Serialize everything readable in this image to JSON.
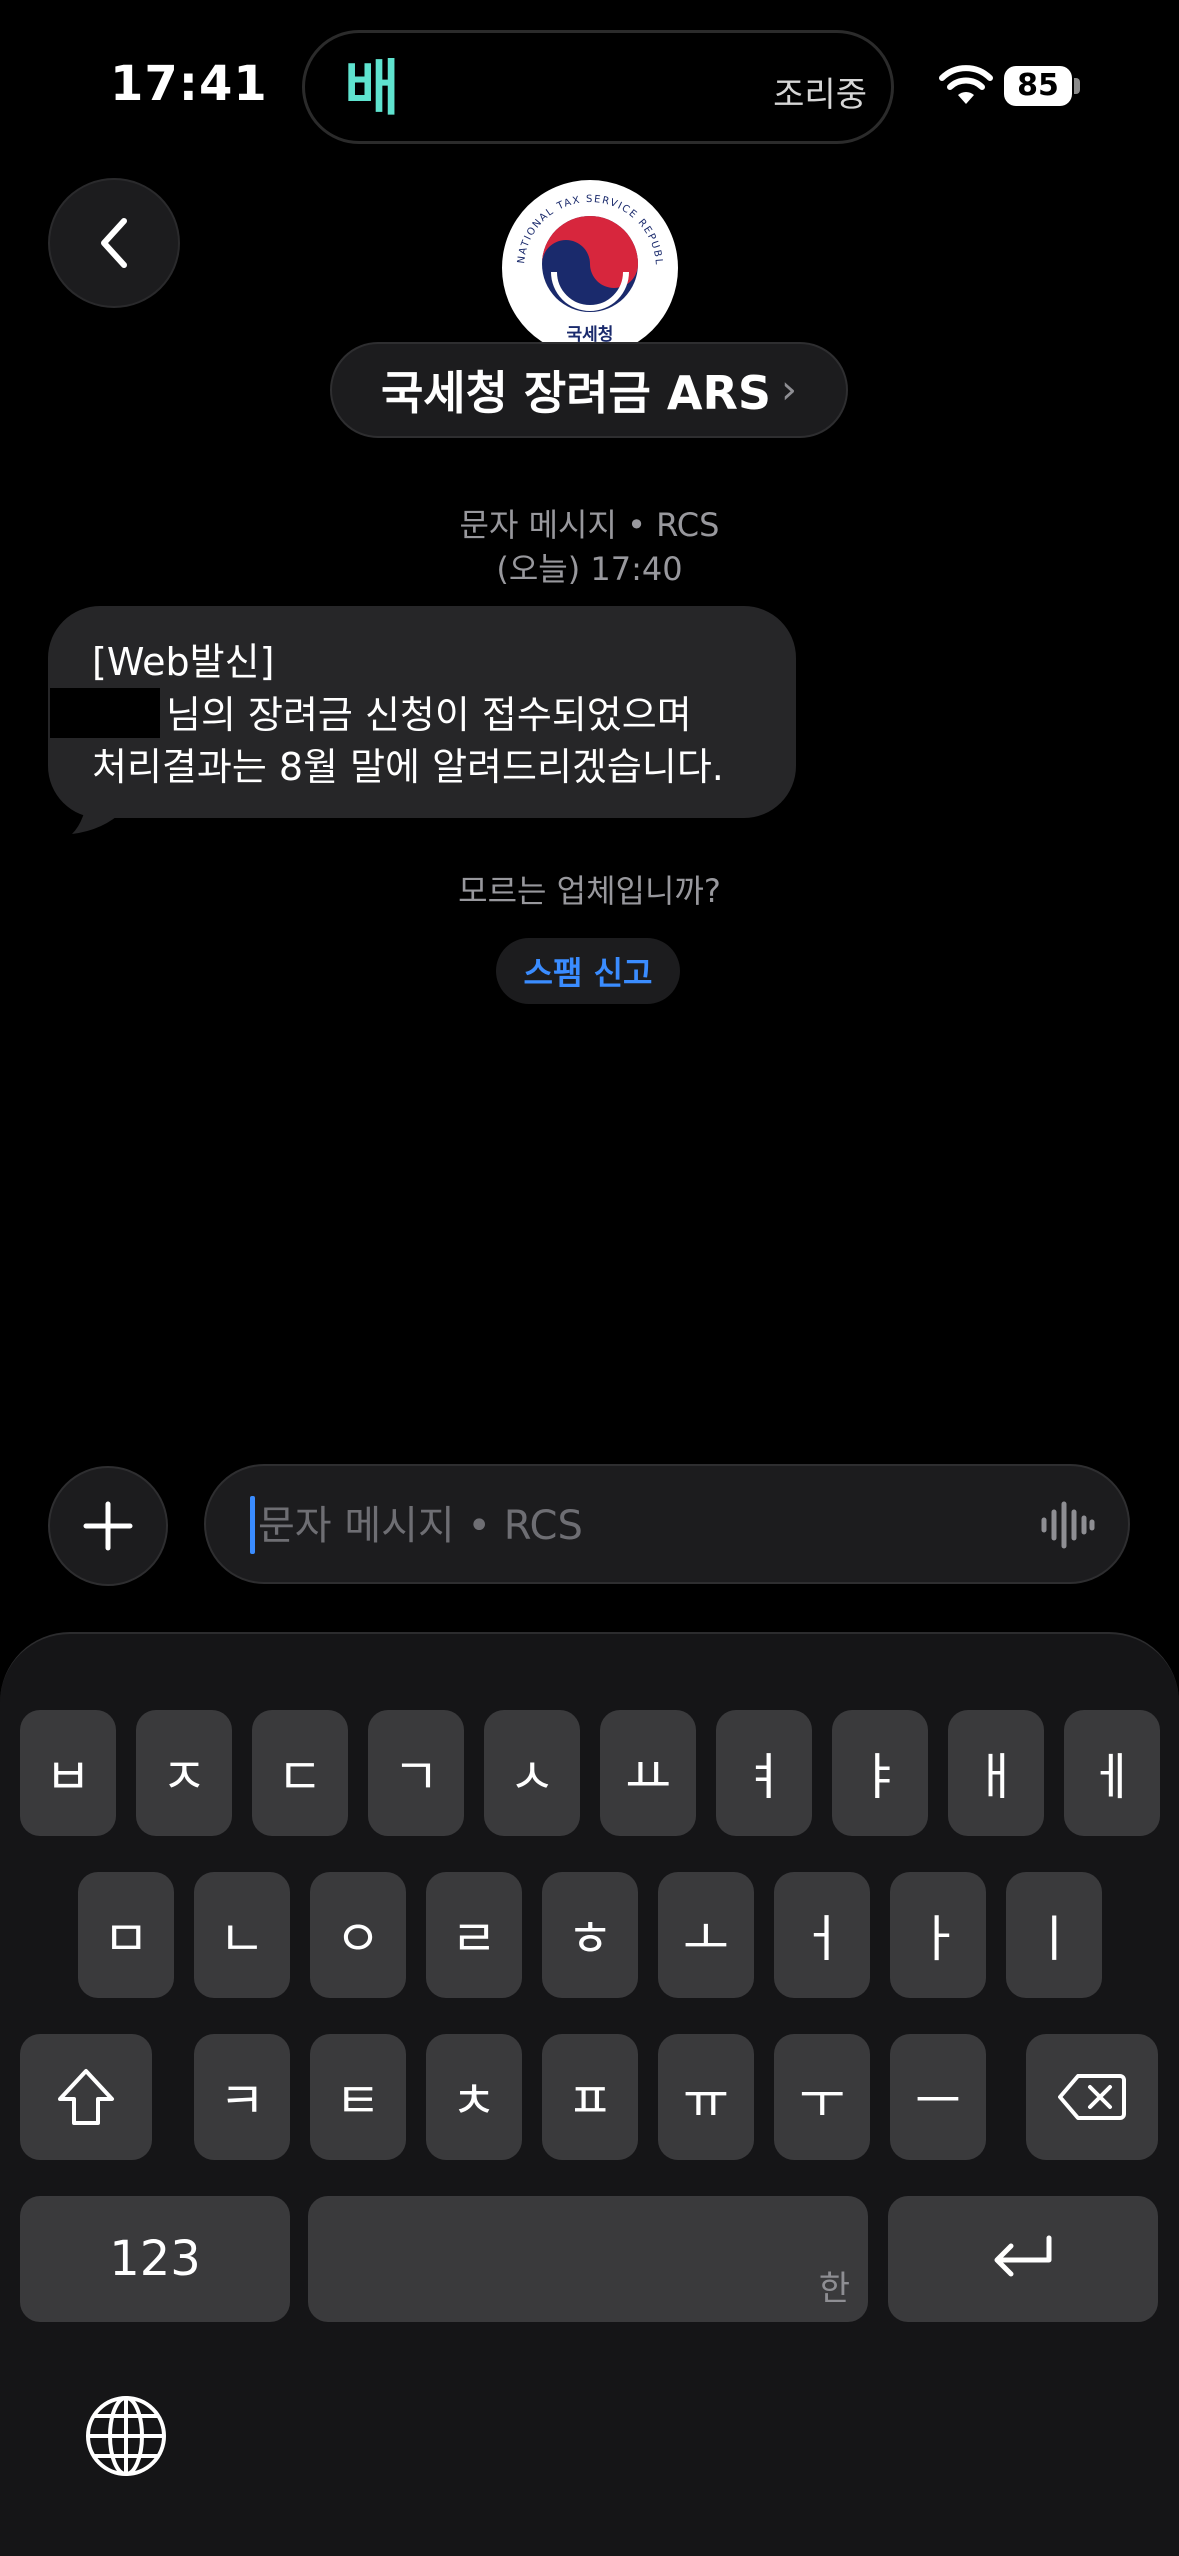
{
  "status_bar": {
    "time": "17:41",
    "island_app_glyph": "배",
    "island_status": "조리중",
    "battery": "85"
  },
  "header": {
    "contact_name": "국세청 장려금 ARS",
    "contact_chevron": "›",
    "avatar_seal_text": "NATIONAL TAX SERVICE REPUBLIC OF KOREA",
    "avatar_label": "국세청"
  },
  "thread": {
    "meta_line1": "문자 메시지 • RCS",
    "meta_line2": "(오늘) 17:40",
    "message_line1": "[Web발신]",
    "message_line2": "님의 장려금 신청이 접수되었으며",
    "message_line3": "처리결과는 8월 말에 알려드리겠습니다.",
    "unknown_sender": "모르는 업체입니까?",
    "spam_report": "스팸 신고"
  },
  "compose": {
    "placeholder": "문자 메시지 • RCS",
    "value": ""
  },
  "keyboard": {
    "row1": [
      "ㅂ",
      "ㅈ",
      "ㄷ",
      "ㄱ",
      "ㅅ",
      "ㅛ",
      "ㅕ",
      "ㅑ",
      "ㅐ",
      "ㅔ"
    ],
    "row2": [
      "ㅁ",
      "ㄴ",
      "ㅇ",
      "ㄹ",
      "ㅎ",
      "ㅗ",
      "ㅓ",
      "ㅏ",
      "ㅣ"
    ],
    "row3": [
      "ㅋ",
      "ㅌ",
      "ㅊ",
      "ㅍ",
      "ㅠ",
      "ㅜ",
      "ㅡ"
    ],
    "numbers_label": "123",
    "space_hint": "한"
  },
  "colors": {
    "accent": "#3a8cff",
    "bubble": "#262628",
    "key": "#3a3a3c"
  }
}
